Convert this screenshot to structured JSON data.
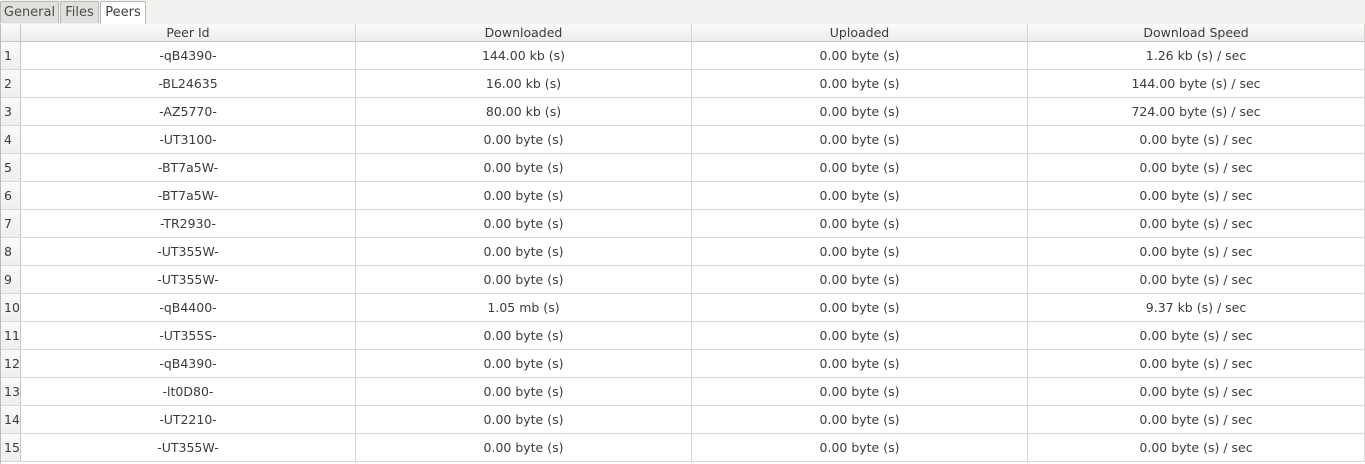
{
  "tabs": [
    {
      "label": "General",
      "active": false
    },
    {
      "label": "Files",
      "active": false
    },
    {
      "label": "Peers",
      "active": true
    }
  ],
  "columns": [
    "Peer Id",
    "Downloaded",
    "Uploaded",
    "Download Speed"
  ],
  "rows": [
    {
      "num": "1",
      "peer": "-qB4390-",
      "downloaded": "144.00 kb (s)",
      "uploaded": "0.00 byte (s)",
      "speed": "1.26 kb (s) / sec"
    },
    {
      "num": "2",
      "peer": "-BL24635",
      "downloaded": "16.00 kb (s)",
      "uploaded": "0.00 byte (s)",
      "speed": "144.00 byte (s) / sec"
    },
    {
      "num": "3",
      "peer": "-AZ5770-",
      "downloaded": "80.00 kb (s)",
      "uploaded": "0.00 byte (s)",
      "speed": "724.00 byte (s) / sec"
    },
    {
      "num": "4",
      "peer": "-UT3100-",
      "downloaded": "0.00 byte (s)",
      "uploaded": "0.00 byte (s)",
      "speed": "0.00 byte (s) / sec"
    },
    {
      "num": "5",
      "peer": "-BT7a5W-",
      "downloaded": "0.00 byte (s)",
      "uploaded": "0.00 byte (s)",
      "speed": "0.00 byte (s) / sec"
    },
    {
      "num": "6",
      "peer": "-BT7a5W-",
      "downloaded": "0.00 byte (s)",
      "uploaded": "0.00 byte (s)",
      "speed": "0.00 byte (s) / sec"
    },
    {
      "num": "7",
      "peer": "-TR2930-",
      "downloaded": "0.00 byte (s)",
      "uploaded": "0.00 byte (s)",
      "speed": "0.00 byte (s) / sec"
    },
    {
      "num": "8",
      "peer": "-UT355W-",
      "downloaded": "0.00 byte (s)",
      "uploaded": "0.00 byte (s)",
      "speed": "0.00 byte (s) / sec"
    },
    {
      "num": "9",
      "peer": "-UT355W-",
      "downloaded": "0.00 byte (s)",
      "uploaded": "0.00 byte (s)",
      "speed": "0.00 byte (s) / sec"
    },
    {
      "num": "10",
      "peer": "-qB4400-",
      "downloaded": "1.05 mb (s)",
      "uploaded": "0.00 byte (s)",
      "speed": "9.37 kb (s) / sec"
    },
    {
      "num": "11",
      "peer": "-UT355S-",
      "downloaded": "0.00 byte (s)",
      "uploaded": "0.00 byte (s)",
      "speed": "0.00 byte (s) / sec"
    },
    {
      "num": "12",
      "peer": "-qB4390-",
      "downloaded": "0.00 byte (s)",
      "uploaded": "0.00 byte (s)",
      "speed": "0.00 byte (s) / sec"
    },
    {
      "num": "13",
      "peer": "-lt0D80-",
      "downloaded": "0.00 byte (s)",
      "uploaded": "0.00 byte (s)",
      "speed": "0.00 byte (s) / sec"
    },
    {
      "num": "14",
      "peer": "-UT2210-",
      "downloaded": "0.00 byte (s)",
      "uploaded": "0.00 byte (s)",
      "speed": "0.00 byte (s) / sec"
    },
    {
      "num": "15",
      "peer": "-UT355W-",
      "downloaded": "0.00 byte (s)",
      "uploaded": "0.00 byte (s)",
      "speed": "0.00 byte (s) / sec"
    }
  ]
}
